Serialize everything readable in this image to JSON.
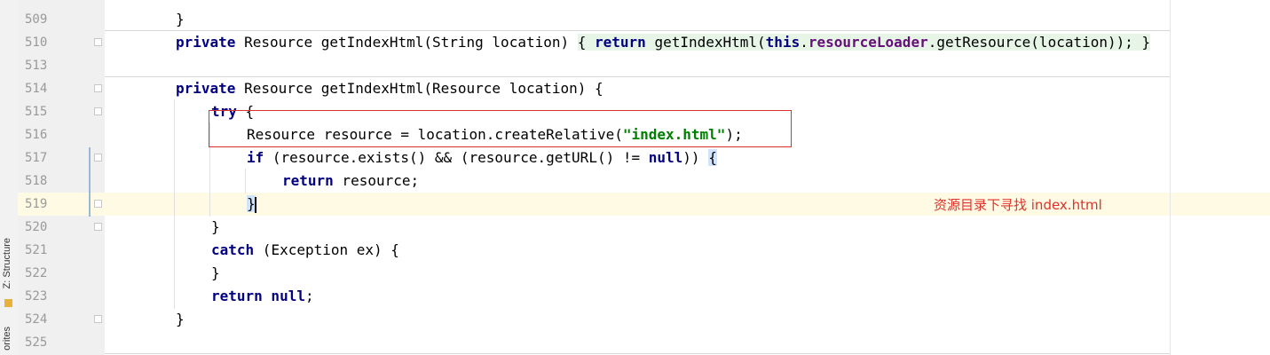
{
  "sidebar": {
    "structure_tab": "Z: Structure",
    "favorites_tab": "orites"
  },
  "editor": {
    "lines": [
      {
        "no": "509",
        "code": "}"
      },
      {
        "no": "510",
        "code": "private Resource getIndexHtml(String location) { return getIndexHtml(this.resourceLoader.getResource(location)); }"
      },
      {
        "no": "513",
        "code": ""
      },
      {
        "no": "514",
        "code": "private Resource getIndexHtml(Resource location) {"
      },
      {
        "no": "515",
        "code": "try {"
      },
      {
        "no": "516",
        "code": "Resource resource = location.createRelative(\"index.html\");"
      },
      {
        "no": "517",
        "code": "if (resource.exists() && (resource.getURL() != null)) {"
      },
      {
        "no": "518",
        "code": "return resource;"
      },
      {
        "no": "519",
        "code": "}"
      },
      {
        "no": "520",
        "code": "}"
      },
      {
        "no": "521",
        "code": "catch (Exception ex) {"
      },
      {
        "no": "522",
        "code": "}"
      },
      {
        "no": "523",
        "code": "return null;"
      },
      {
        "no": "524",
        "code": "}"
      },
      {
        "no": "525",
        "code": ""
      }
    ]
  },
  "annotation": {
    "note": "资源目录下寻找 index.html",
    "color": "#e0322b"
  },
  "colors": {
    "keyword": "#000080",
    "string": "#008000",
    "field": "#660e7a",
    "current_line": "#fffae3"
  }
}
